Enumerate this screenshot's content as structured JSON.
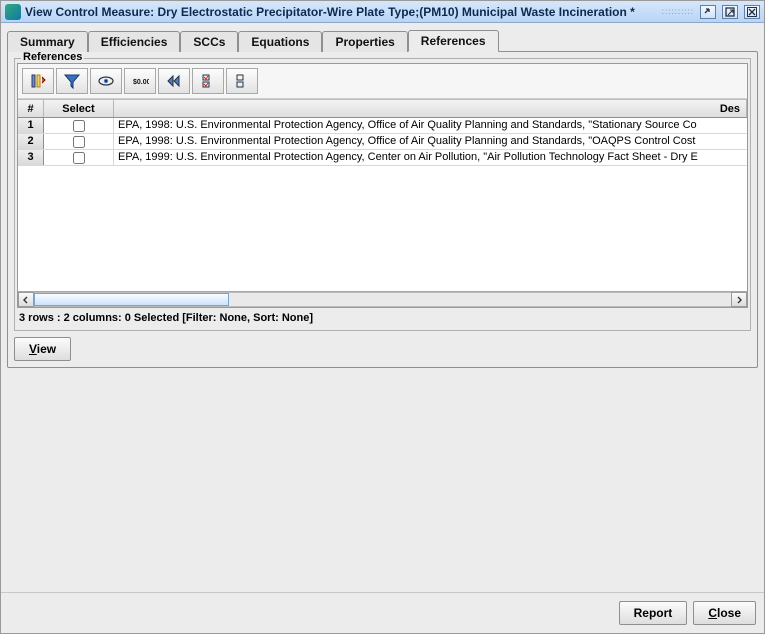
{
  "titlebar": {
    "title": "View Control Measure: Dry Electrostatic Precipitator-Wire Plate Type;(PM10) Municipal Waste Incineration *"
  },
  "tabs": [
    {
      "label": "Summary",
      "active": false
    },
    {
      "label": "Efficiencies",
      "active": false
    },
    {
      "label": "SCCs",
      "active": false
    },
    {
      "label": "Equations",
      "active": false
    },
    {
      "label": "Properties",
      "active": false
    },
    {
      "label": "References",
      "active": true
    }
  ],
  "panel_legend": "References",
  "table": {
    "columns": {
      "num": "#",
      "select": "Select",
      "desc": "Des"
    },
    "rows": [
      {
        "num": "1",
        "desc": "EPA, 1998: U.S. Environmental Protection Agency, Office of Air Quality Planning and Standards, \"Stationary Source Co"
      },
      {
        "num": "2",
        "desc": "EPA, 1998: U.S. Environmental Protection Agency, Office of Air Quality Planning and Standards, \"OAQPS Control Cost"
      },
      {
        "num": "3",
        "desc": "EPA, 1999:  U.S. Environmental Protection Agency, Center on Air Pollution, \"Air Pollution Technology Fact Sheet - Dry E"
      }
    ]
  },
  "status": "3 rows : 2 columns: 0 Selected [Filter: None, Sort: None]",
  "buttons": {
    "view_pre": "",
    "view_mn": "V",
    "view_post": "iew",
    "report": "Report",
    "close_pre": "",
    "close_mn": "C",
    "close_post": "lose"
  },
  "toolbar_icons": [
    "sort-columns",
    "filter",
    "view-eye",
    "format-price",
    "rewind",
    "select-all",
    "select-none"
  ]
}
